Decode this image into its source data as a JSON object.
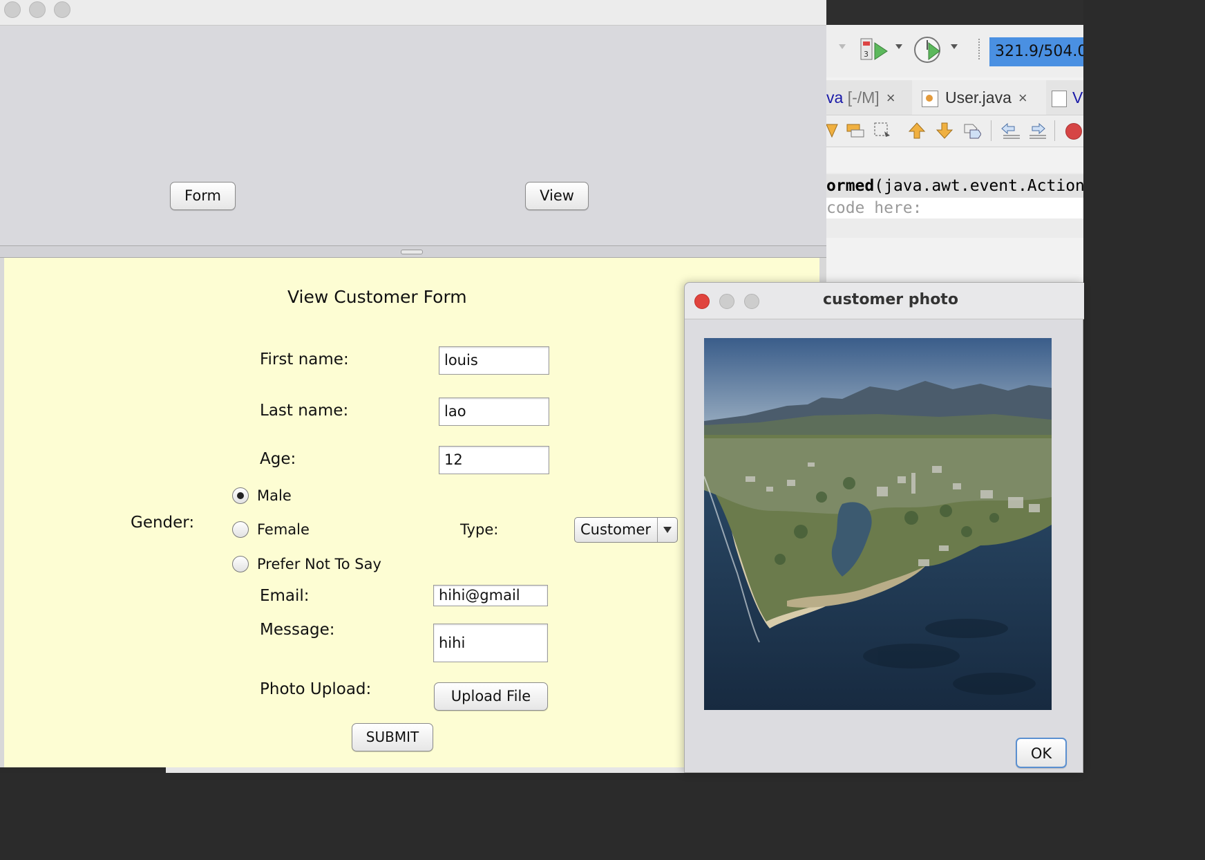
{
  "ide": {
    "memory_indicator": "321.9/504.0",
    "tabs": [
      {
        "label_main": "va",
        "label_dim": " [-/M]",
        "close": "×"
      },
      {
        "label_main": "User.java",
        "label_dim": "",
        "close": "×"
      },
      {
        "label_main": "V",
        "label_dim": "",
        "close": ""
      }
    ],
    "code": {
      "line1_bold": "ormed",
      "line1_rest": "(java.awt.event.Action",
      "line2": "code here:"
    }
  },
  "main_window": {
    "form_button": "Form",
    "view_button": "View"
  },
  "form": {
    "title": "View Customer Form",
    "first_name_label": "First name:",
    "first_name_value": "louis",
    "last_name_label": "Last name:",
    "last_name_value": "lao",
    "age_label": "Age:",
    "age_value": "12",
    "gender_label": "Gender:",
    "gender_options": [
      "Male",
      "Female",
      "Prefer Not To Say"
    ],
    "gender_selected": "Male",
    "type_label": "Type:",
    "type_value": "Customer",
    "email_label": "Email:",
    "email_value": "hihi@gmail",
    "message_label": "Message:",
    "message_value": "hihi",
    "photo_label": "Photo Upload:",
    "upload_button": "Upload File",
    "submit_button": "SUBMIT"
  },
  "dialog": {
    "title": "customer photo",
    "ok_button": "OK"
  },
  "colors": {
    "form_background": "#fdfdd3",
    "memory_bar": "#4a90e2",
    "close_light": "#e0443e"
  }
}
